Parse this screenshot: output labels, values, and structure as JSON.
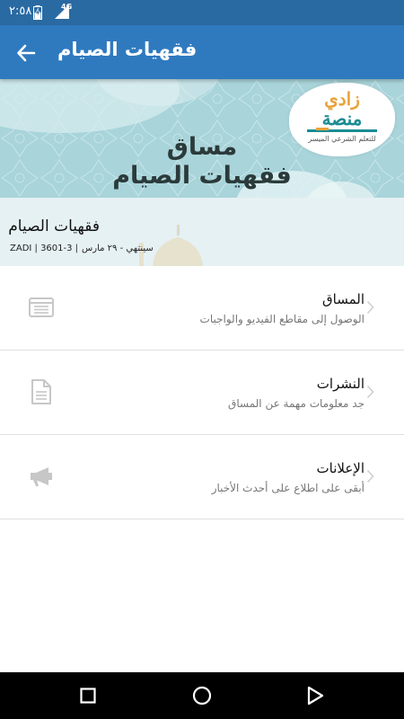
{
  "status_bar": {
    "time": "٢:٥٨",
    "network": "4G",
    "icons": [
      "battery-charging-icon",
      "signal-icon"
    ]
  },
  "app_bar": {
    "title": "فقهيات الصيام",
    "back_icon": "arrow-back-icon"
  },
  "banner": {
    "line1": "مساق",
    "line2": "فقهيات الصيام",
    "logo": {
      "word1": "زادي",
      "word2": "منصة",
      "tagline": "للتعلم الشرعي الميسر"
    }
  },
  "course": {
    "title": "فقهيات الصيام",
    "code": "ZADI | 3601-3 |",
    "end_date": "سينتهي - ٢٩ مارس"
  },
  "menu": [
    {
      "title": "المساق",
      "subtitle": "الوصول إلى مقاطع الفيديو والواجبات",
      "icon": "browser-window-icon"
    },
    {
      "title": "النشرات",
      "subtitle": "جد معلومات مهمة عن المساق",
      "icon": "document-icon"
    },
    {
      "title": "الإعلانات",
      "subtitle": "أبقى على اطلاع على أحدث الأخبار",
      "icon": "megaphone-icon"
    }
  ],
  "nav_bar": {
    "icons": [
      "recents-square-icon",
      "home-circle-icon",
      "back-triangle-icon"
    ]
  },
  "colors": {
    "status_bar": "#2a6aa3",
    "app_bar": "#2f7abf",
    "banner": "#a8d4da",
    "course_header": "#e6f1f4"
  }
}
